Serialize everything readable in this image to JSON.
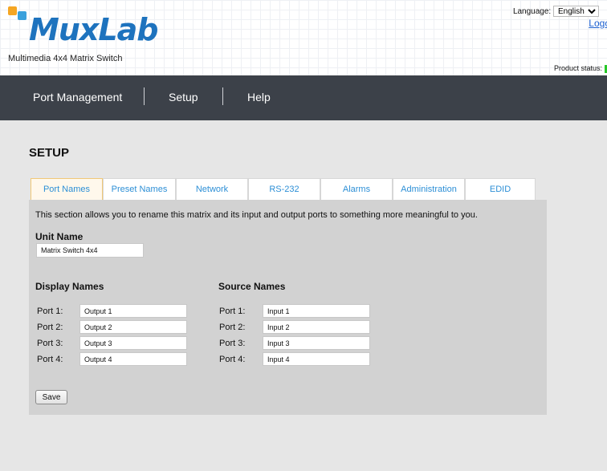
{
  "header": {
    "logo_text": "MuxLab",
    "subtitle": "Multimedia 4x4 Matrix Switch",
    "language_label": "Language:",
    "language_value": "English",
    "logout_label": "Logo",
    "product_status_label": "Product status:",
    "status_color": "#28c828"
  },
  "nav": {
    "items": [
      {
        "label": "Port Management"
      },
      {
        "label": "Setup"
      },
      {
        "label": "Help"
      }
    ]
  },
  "page": {
    "title": "SETUP"
  },
  "tabs": [
    {
      "label": "Port Names",
      "active": true
    },
    {
      "label": "Preset Names"
    },
    {
      "label": "Network"
    },
    {
      "label": "RS-232"
    },
    {
      "label": "Alarms"
    },
    {
      "label": "Administration"
    },
    {
      "label": "EDID"
    }
  ],
  "panel": {
    "intro": "This section allows you to rename this matrix and its input and output ports to something more meaningful to you.",
    "unit_name_label": "Unit Name",
    "unit_name_value": "Matrix Switch 4x4",
    "display_names_label": "Display Names",
    "source_names_label": "Source Names",
    "display_ports": [
      {
        "label": "Port 1:",
        "value": "Output 1"
      },
      {
        "label": "Port 2:",
        "value": "Output 2"
      },
      {
        "label": "Port 3:",
        "value": "Output 3"
      },
      {
        "label": "Port 4:",
        "value": "Output 4"
      }
    ],
    "source_ports": [
      {
        "label": "Port 1:",
        "value": "Input 1"
      },
      {
        "label": "Port 2:",
        "value": "Input 2"
      },
      {
        "label": "Port 3:",
        "value": "Input 3"
      },
      {
        "label": "Port 4:",
        "value": "Input 4"
      }
    ],
    "save_label": "Save"
  },
  "colors": {
    "nav_bg": "#3c4149",
    "accent_blue": "#2d8fd6",
    "active_tab_border": "#f0c878",
    "panel_bg": "#d2d2d2"
  }
}
